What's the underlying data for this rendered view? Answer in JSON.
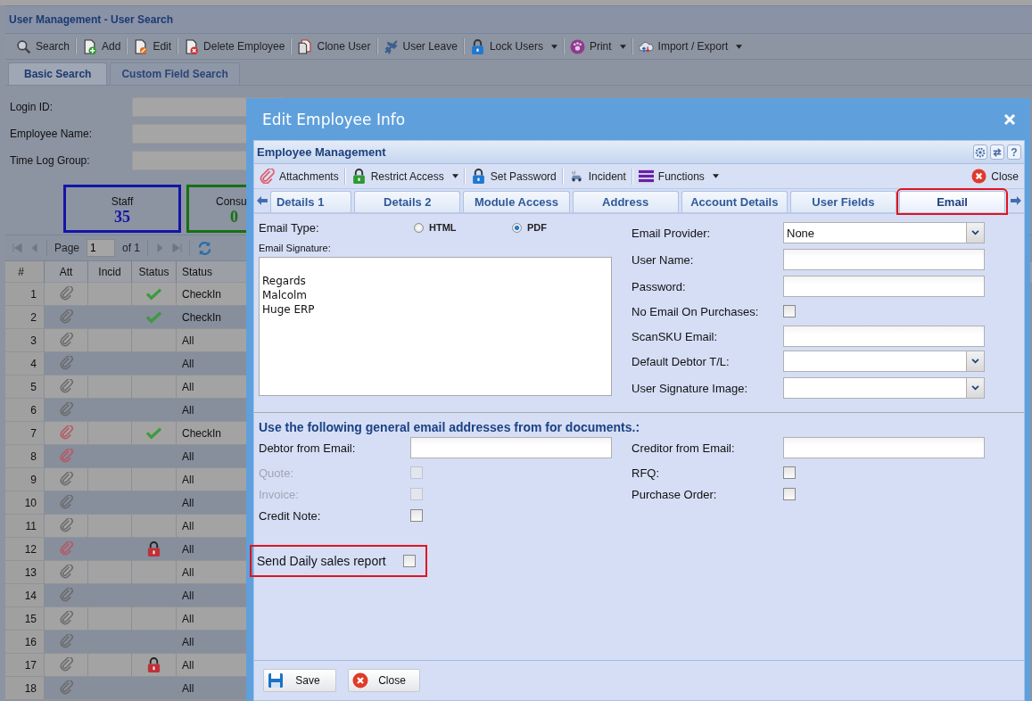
{
  "app": {
    "title": "User Management - User Search",
    "toolbar": [
      {
        "label": "Search",
        "dropdown": false
      },
      {
        "label": "Add",
        "dropdown": false
      },
      {
        "label": "Edit",
        "dropdown": false
      },
      {
        "label": "Delete Employee",
        "dropdown": false
      },
      {
        "label": "Clone User",
        "dropdown": false
      },
      {
        "label": "User Leave",
        "dropdown": false
      },
      {
        "label": "Lock Users",
        "dropdown": true
      },
      {
        "label": "Print",
        "dropdown": true
      },
      {
        "label": "Import / Export",
        "dropdown": true
      }
    ],
    "tabs": [
      {
        "label": "Basic Search",
        "selected": true
      },
      {
        "label": "Custom Field Search",
        "selected": false
      }
    ],
    "fields": [
      {
        "label": "Login ID:"
      },
      {
        "label": "Employee Name:"
      },
      {
        "label": "Time Log Group:"
      }
    ],
    "cards": [
      {
        "label": "Staff",
        "value": "35",
        "color": "#1414a8"
      },
      {
        "label": "Consu",
        "value": "0",
        "color": "#157015"
      }
    ],
    "pager": {
      "label": "Page",
      "page": "1",
      "total": "of 1"
    },
    "grid": {
      "columns": [
        "#",
        "Att",
        "Incid",
        "Status",
        "Status"
      ],
      "rows": [
        {
          "num": "1",
          "flagged": false,
          "checked_in": true,
          "locked": false,
          "status": "CheckIn"
        },
        {
          "num": "2",
          "flagged": false,
          "checked_in": true,
          "locked": false,
          "status": "CheckIn"
        },
        {
          "num": "3",
          "flagged": false,
          "checked_in": false,
          "locked": false,
          "status": "All"
        },
        {
          "num": "4",
          "flagged": false,
          "checked_in": false,
          "locked": false,
          "status": "All"
        },
        {
          "num": "5",
          "flagged": false,
          "checked_in": false,
          "locked": false,
          "status": "All"
        },
        {
          "num": "6",
          "flagged": false,
          "checked_in": false,
          "locked": false,
          "status": "All"
        },
        {
          "num": "7",
          "flagged": true,
          "checked_in": true,
          "locked": false,
          "status": "CheckIn"
        },
        {
          "num": "8",
          "flagged": true,
          "checked_in": false,
          "locked": false,
          "status": "All"
        },
        {
          "num": "9",
          "flagged": false,
          "checked_in": false,
          "locked": false,
          "status": "All"
        },
        {
          "num": "10",
          "flagged": false,
          "checked_in": false,
          "locked": false,
          "status": "All"
        },
        {
          "num": "11",
          "flagged": false,
          "checked_in": false,
          "locked": false,
          "status": "All"
        },
        {
          "num": "12",
          "flagged": true,
          "checked_in": false,
          "locked": true,
          "status": "All"
        },
        {
          "num": "13",
          "flagged": false,
          "checked_in": false,
          "locked": false,
          "status": "All"
        },
        {
          "num": "14",
          "flagged": false,
          "checked_in": false,
          "locked": false,
          "status": "All"
        },
        {
          "num": "15",
          "flagged": false,
          "checked_in": false,
          "locked": false,
          "status": "All"
        },
        {
          "num": "16",
          "flagged": false,
          "checked_in": false,
          "locked": false,
          "status": "All"
        },
        {
          "num": "17",
          "flagged": false,
          "checked_in": false,
          "locked": true,
          "status": "All"
        },
        {
          "num": "18",
          "flagged": false,
          "checked_in": false,
          "locked": false,
          "status": "All"
        }
      ]
    }
  },
  "dialog": {
    "title": "Edit Employee Info",
    "panel_title": "Employee Management",
    "help_label": "?",
    "toolbar": [
      {
        "label": "Attachments",
        "dropdown": false
      },
      {
        "label": "Restrict Access",
        "dropdown": true
      },
      {
        "label": "Set Password",
        "dropdown": false
      },
      {
        "label": "Incident",
        "dropdown": false
      },
      {
        "label": "Functions",
        "dropdown": true
      }
    ],
    "close_label": "Close",
    "tabs": [
      {
        "label": "Details 1",
        "selected": false,
        "highlighted": false
      },
      {
        "label": "Details 2",
        "selected": false,
        "highlighted": false
      },
      {
        "label": "Module Access",
        "selected": false,
        "highlighted": false
      },
      {
        "label": "Address",
        "selected": false,
        "highlighted": false
      },
      {
        "label": "Account Details",
        "selected": false,
        "highlighted": false
      },
      {
        "label": "User Fields",
        "selected": false,
        "highlighted": false
      },
      {
        "label": "Email",
        "selected": true,
        "highlighted": true
      }
    ],
    "email_type": {
      "label": "Email Type:",
      "options": [
        {
          "label": "HTML",
          "selected": false
        },
        {
          "label": "PDF",
          "selected": true
        }
      ]
    },
    "signature": {
      "label": "Email Signature:",
      "value": "\nRegards\nMalcolm\nHuge ERP"
    },
    "right_fields": [
      {
        "label": "Email Provider:",
        "kind": "select",
        "value": "None"
      },
      {
        "label": "User Name:",
        "kind": "text"
      },
      {
        "label": "Password:",
        "kind": "text"
      },
      {
        "label": "No Email On Purchases:",
        "kind": "checkbox",
        "checked": false
      },
      {
        "label": "ScanSKU Email:",
        "kind": "text"
      },
      {
        "label": "Default Debtor T/L:",
        "kind": "select"
      },
      {
        "label": "User Signature Image:",
        "kind": "select"
      }
    ],
    "section_title": "Use the following general email addresses from for documents.:",
    "left_docs": [
      {
        "label": "Debtor from Email:",
        "kind": "text"
      },
      {
        "label": "Quote:",
        "kind": "checkbox",
        "checked": false,
        "disabled": true
      },
      {
        "label": "Invoice:",
        "kind": "checkbox",
        "checked": false,
        "disabled": true
      },
      {
        "label": "Credit Note:",
        "kind": "checkbox",
        "checked": false,
        "disabled": false
      }
    ],
    "right_docs": [
      {
        "label": "Creditor from Email:",
        "kind": "text"
      },
      {
        "label": "RFQ:",
        "kind": "checkbox",
        "checked": false,
        "disabled": false
      },
      {
        "label": "Purchase Order:",
        "kind": "checkbox",
        "checked": false,
        "disabled": false
      }
    ],
    "daily_report": {
      "label": "Send Daily sales report",
      "checked": false,
      "highlighted": true
    },
    "buttons": [
      {
        "label": "Save"
      },
      {
        "label": "Close"
      }
    ]
  }
}
